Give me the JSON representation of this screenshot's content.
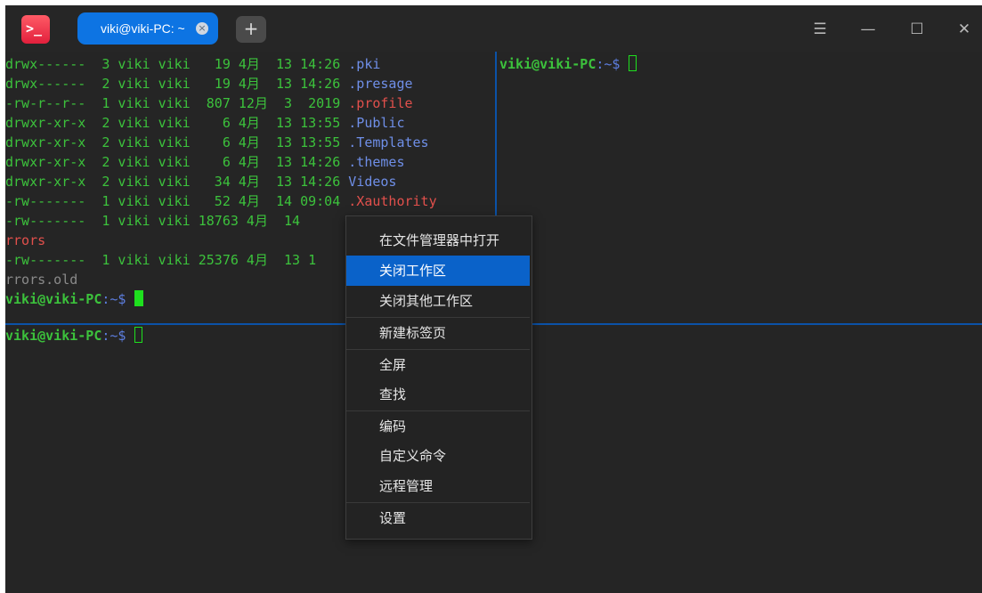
{
  "app": {
    "icon_name": "terminal-icon",
    "icon_glyph": ">_",
    "tabs": [
      {
        "label": "viki@viki-PC: ~",
        "close_glyph": "×",
        "active": true
      }
    ],
    "new_tab_glyph": "+",
    "controls": {
      "menu_glyph": "☰",
      "minimize_glyph": "—",
      "maximize_glyph": "☐",
      "close_glyph": "✕"
    }
  },
  "colors": {
    "accent": "#0d74e3",
    "terminal_bg": "#252525",
    "file_text": "#3cc23c",
    "dir_name": "#6f8fe8",
    "hidden_file": "#e2504c",
    "menu_highlight": "#0a62c9"
  },
  "panes": {
    "top_left": {
      "lines": [
        {
          "a": "drwx------  3 viki viki   19 4月  13 14:26 ",
          "name": ".pki",
          "kind": "dir"
        },
        {
          "a": "drwx------  2 viki viki   19 4月  13 14:26 ",
          "name": ".presage",
          "kind": "dir"
        },
        {
          "a": "-rw-r--r--  1 viki viki  807 12月  3  2019 ",
          "name": ".profile",
          "kind": "file"
        },
        {
          "a": "drwxr-xr-x  2 viki viki    6 4月  13 13:55 ",
          "name": ".Public",
          "kind": "dir"
        },
        {
          "a": "drwxr-xr-x  2 viki viki    6 4月  13 13:55 ",
          "name": ".Templates",
          "kind": "dir"
        },
        {
          "a": "drwxr-xr-x  2 viki viki    6 4月  13 14:26 ",
          "name": ".themes",
          "kind": "dir"
        },
        {
          "a": "drwxr-xr-x  2 viki viki   34 4月  13 14:26 ",
          "name": "Videos",
          "kind": "dir"
        },
        {
          "a": "-rw-------  1 viki viki   52 4月  14 09:04 ",
          "name": ".Xauthority",
          "kind": "file"
        },
        {
          "a": "-rw-------  1 viki viki 18763 4月  14 ",
          "name": "",
          "kind": "file"
        },
        {
          "a": "",
          "name": "rrors",
          "kind": "file"
        },
        {
          "a": "-rw-------  1 viki viki 25376 4月  13 1",
          "name": "",
          "kind": "file"
        },
        {
          "a": "",
          "name": "rrors.old",
          "kind": "dim"
        }
      ],
      "prompt_user": "viki@viki-PC",
      "prompt_path": ":~$ "
    },
    "top_right": {
      "prompt_user": "viki@viki-PC",
      "prompt_path": ":~$ "
    },
    "bottom": {
      "prompt_user": "viki@viki-PC",
      "prompt_path": ":~$ "
    }
  },
  "context_menu": {
    "items": [
      {
        "label": "在文件管理器中打开"
      },
      {
        "label": "关闭工作区",
        "active": true
      },
      {
        "label": "关闭其他工作区"
      },
      {
        "label": "新建标签页"
      },
      {
        "label": "全屏"
      },
      {
        "label": "查找"
      },
      {
        "label": "编码"
      },
      {
        "label": "自定义命令"
      },
      {
        "label": "远程管理"
      },
      {
        "label": "设置"
      }
    ]
  }
}
